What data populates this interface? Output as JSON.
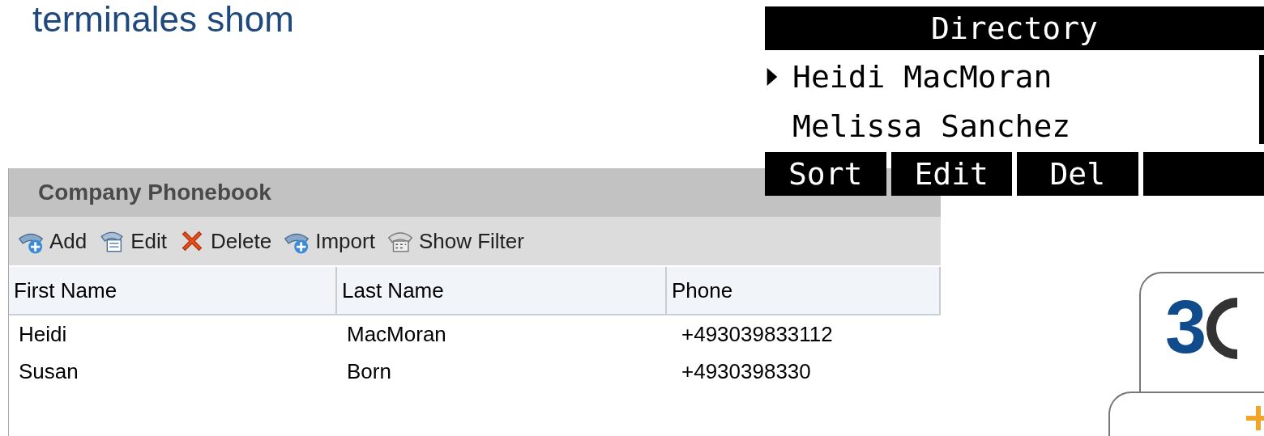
{
  "slide_title": "terminales shom",
  "phone_display": {
    "title": "Directory",
    "entries": [
      {
        "name": "Heidi MacMoran",
        "selected": true
      },
      {
        "name": "Melissa Sanchez",
        "selected": false
      }
    ],
    "softkeys": [
      "Sort",
      "Edit",
      "Del"
    ]
  },
  "phonebook": {
    "title": "Company Phonebook",
    "toolbar": [
      {
        "label": "Add",
        "kind": "add"
      },
      {
        "label": "Edit",
        "kind": "edit"
      },
      {
        "label": "Delete",
        "kind": "delete"
      },
      {
        "label": "Import",
        "kind": "import"
      },
      {
        "label": "Show Filter",
        "kind": "filter"
      }
    ],
    "columns": [
      "First Name",
      "Last Name",
      "Phone"
    ],
    "rows": [
      [
        "Heidi",
        "MacMoran",
        "+493039833112"
      ],
      [
        "Susan",
        "Born",
        "+4930398330"
      ]
    ]
  },
  "logo": {
    "text": "3"
  }
}
